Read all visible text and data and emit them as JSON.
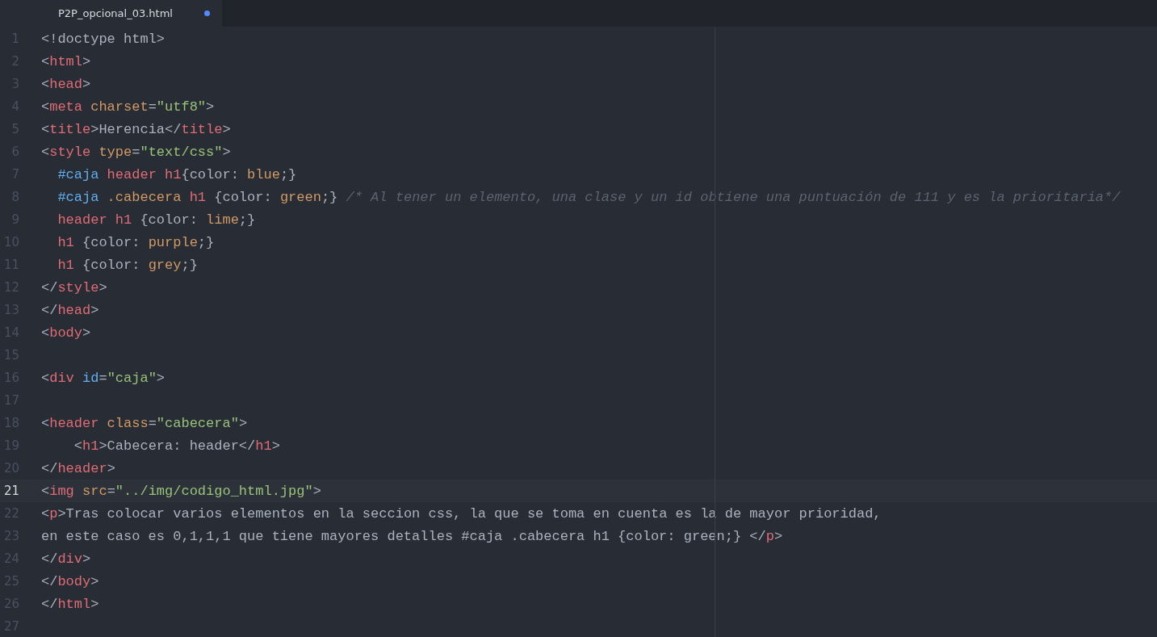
{
  "tab": {
    "title": "P2P_opcional_03.html",
    "modified": true,
    "selected": true
  },
  "lines": [
    {
      "number": "1",
      "current": false,
      "tokens": [
        {
          "kind": "punct",
          "text": "<!doctype html>"
        }
      ]
    },
    {
      "number": "2",
      "current": false,
      "tokens": [
        {
          "kind": "punct",
          "text": "<"
        },
        {
          "kind": "tag",
          "text": "html"
        },
        {
          "kind": "punct",
          "text": ">"
        }
      ]
    },
    {
      "number": "3",
      "current": false,
      "tokens": [
        {
          "kind": "punct",
          "text": "<"
        },
        {
          "kind": "tag",
          "text": "head"
        },
        {
          "kind": "punct",
          "text": ">"
        }
      ]
    },
    {
      "number": "4",
      "current": false,
      "tokens": [
        {
          "kind": "punct",
          "text": "<"
        },
        {
          "kind": "tag",
          "text": "meta"
        },
        {
          "kind": "attr",
          "text": " charset"
        },
        {
          "kind": "punct",
          "text": "="
        },
        {
          "kind": "string",
          "text": "\"utf8\""
        },
        {
          "kind": "punct",
          "text": ">"
        }
      ]
    },
    {
      "number": "5",
      "current": false,
      "tokens": [
        {
          "kind": "punct",
          "text": "<"
        },
        {
          "kind": "tag",
          "text": "title"
        },
        {
          "kind": "punct",
          "text": ">Herencia</"
        },
        {
          "kind": "tag",
          "text": "title"
        },
        {
          "kind": "punct",
          "text": ">"
        }
      ]
    },
    {
      "number": "6",
      "current": false,
      "tokens": [
        {
          "kind": "punct",
          "text": "<"
        },
        {
          "kind": "tag",
          "text": "style"
        },
        {
          "kind": "attr",
          "text": " type"
        },
        {
          "kind": "punct",
          "text": "="
        },
        {
          "kind": "string",
          "text": "\"text/css\""
        },
        {
          "kind": "punct",
          "text": ">"
        }
      ]
    },
    {
      "number": "7",
      "current": false,
      "tokens": [
        {
          "kind": "id",
          "text": "  #caja"
        },
        {
          "kind": "tag",
          "text": " header h1"
        },
        {
          "kind": "punct",
          "text": "{color: "
        },
        {
          "kind": "value",
          "text": "blue"
        },
        {
          "kind": "punct",
          "text": ";}"
        }
      ]
    },
    {
      "number": "8",
      "current": false,
      "tokens": [
        {
          "kind": "id",
          "text": "  #caja"
        },
        {
          "kind": "attr",
          "text": " .cabecera"
        },
        {
          "kind": "tag",
          "text": " h1"
        },
        {
          "kind": "punct",
          "text": " {color: "
        },
        {
          "kind": "value",
          "text": "green"
        },
        {
          "kind": "punct",
          "text": ";} "
        },
        {
          "kind": "comment",
          "text": "/* Al tener un elemento, una clase y un id obtiene una puntuación de 111 y es la prioritaria*/"
        }
      ]
    },
    {
      "number": "9",
      "current": false,
      "tokens": [
        {
          "kind": "tag",
          "text": "  header h1"
        },
        {
          "kind": "punct",
          "text": " {color: "
        },
        {
          "kind": "value",
          "text": "lime"
        },
        {
          "kind": "punct",
          "text": ";}"
        }
      ]
    },
    {
      "number": "10",
      "current": false,
      "tokens": [
        {
          "kind": "tag",
          "text": "  h1"
        },
        {
          "kind": "punct",
          "text": " {color: "
        },
        {
          "kind": "value",
          "text": "purple"
        },
        {
          "kind": "punct",
          "text": ";}"
        }
      ]
    },
    {
      "number": "11",
      "current": false,
      "tokens": [
        {
          "kind": "tag",
          "text": "  h1"
        },
        {
          "kind": "punct",
          "text": " {color: "
        },
        {
          "kind": "value",
          "text": "grey"
        },
        {
          "kind": "punct",
          "text": ";}"
        }
      ]
    },
    {
      "number": "12",
      "current": false,
      "tokens": [
        {
          "kind": "punct",
          "text": "</"
        },
        {
          "kind": "tag",
          "text": "style"
        },
        {
          "kind": "punct",
          "text": ">"
        }
      ]
    },
    {
      "number": "13",
      "current": false,
      "tokens": [
        {
          "kind": "punct",
          "text": "</"
        },
        {
          "kind": "tag",
          "text": "head"
        },
        {
          "kind": "punct",
          "text": ">"
        }
      ]
    },
    {
      "number": "14",
      "current": false,
      "tokens": [
        {
          "kind": "punct",
          "text": "<"
        },
        {
          "kind": "tag",
          "text": "body"
        },
        {
          "kind": "punct",
          "text": ">"
        }
      ]
    },
    {
      "number": "15",
      "current": false
    },
    {
      "number": "16",
      "current": false,
      "tokens": [
        {
          "kind": "punct",
          "text": "<"
        },
        {
          "kind": "tag",
          "text": "div"
        },
        {
          "kind": "id",
          "text": " id"
        },
        {
          "kind": "punct",
          "text": "="
        },
        {
          "kind": "string",
          "text": "\"caja\""
        },
        {
          "kind": "punct",
          "text": ">"
        }
      ]
    },
    {
      "number": "17",
      "current": false
    },
    {
      "number": "18",
      "current": false,
      "tokens": [
        {
          "kind": "punct",
          "text": "<"
        },
        {
          "kind": "tag",
          "text": "header"
        },
        {
          "kind": "attr",
          "text": " class"
        },
        {
          "kind": "punct",
          "text": "="
        },
        {
          "kind": "string",
          "text": "\"cabecera\""
        },
        {
          "kind": "punct",
          "text": ">"
        }
      ]
    },
    {
      "number": "19",
      "current": false,
      "tokens": [
        {
          "kind": "punct",
          "text": "    <"
        },
        {
          "kind": "tag",
          "text": "h1"
        },
        {
          "kind": "punct",
          "text": ">Cabecera: header</"
        },
        {
          "kind": "tag",
          "text": "h1"
        },
        {
          "kind": "punct",
          "text": ">"
        }
      ]
    },
    {
      "number": "20",
      "current": false,
      "tokens": [
        {
          "kind": "punct",
          "text": "</"
        },
        {
          "kind": "tag",
          "text": "header"
        },
        {
          "kind": "punct",
          "text": ">"
        }
      ]
    },
    {
      "number": "21",
      "current": true,
      "tokens": [
        {
          "kind": "punct",
          "text": "<"
        },
        {
          "kind": "tag",
          "text": "img"
        },
        {
          "kind": "attr",
          "text": " src"
        },
        {
          "kind": "punct",
          "text": "="
        },
        {
          "kind": "string",
          "text": "\"../img/codigo_html.jpg\""
        },
        {
          "kind": "punct",
          "text": ">"
        }
      ]
    },
    {
      "number": "22",
      "current": false,
      "tokens": [
        {
          "kind": "punct",
          "text": "<"
        },
        {
          "kind": "tag",
          "text": "p"
        },
        {
          "kind": "punct",
          "text": ">Tras colocar varios elementos en la seccion css, la que se toma en cuenta es la de mayor prioridad,"
        }
      ]
    },
    {
      "number": "23",
      "current": false,
      "tokens": [
        {
          "kind": "punct",
          "text": "en este caso es 0,1,1,1 que tiene mayores detalles #caja .cabecera h1 {color: green;} </"
        },
        {
          "kind": "tag",
          "text": "p"
        },
        {
          "kind": "punct",
          "text": ">"
        }
      ]
    },
    {
      "number": "24",
      "current": false,
      "tokens": [
        {
          "kind": "punct",
          "text": "</"
        },
        {
          "kind": "tag",
          "text": "div"
        },
        {
          "kind": "punct",
          "text": ">"
        }
      ]
    },
    {
      "number": "25",
      "current": false,
      "tokens": [
        {
          "kind": "punct",
          "text": "</"
        },
        {
          "kind": "tag",
          "text": "body"
        },
        {
          "kind": "punct",
          "text": ">"
        }
      ]
    },
    {
      "number": "26",
      "current": false,
      "tokens": [
        {
          "kind": "punct",
          "text": "</"
        },
        {
          "kind": "tag",
          "text": "html"
        },
        {
          "kind": "punct",
          "text": ">"
        }
      ]
    },
    {
      "number": "27",
      "current": false
    }
  ]
}
